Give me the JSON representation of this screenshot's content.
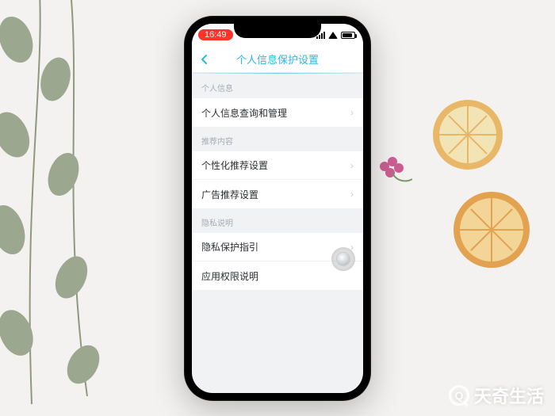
{
  "background_watermark": "天奇生活",
  "statusbar": {
    "time": "16:49"
  },
  "navbar": {
    "title": "个人信息保护设置"
  },
  "sections": [
    {
      "header": "个人信息",
      "rows": [
        {
          "label": "个人信息查询和管理",
          "has_chevron": true
        }
      ]
    },
    {
      "header": "推荐内容",
      "rows": [
        {
          "label": "个性化推荐设置",
          "has_chevron": true
        },
        {
          "label": "广告推荐设置",
          "has_chevron": true
        }
      ]
    },
    {
      "header": "隐私说明",
      "rows": [
        {
          "label": "隐私保护指引",
          "has_chevron": true
        },
        {
          "label": "应用权限说明",
          "has_chevron": false
        }
      ]
    }
  ],
  "colors": {
    "accent": "#2ab9e6",
    "time_pill": "#ff3329"
  }
}
